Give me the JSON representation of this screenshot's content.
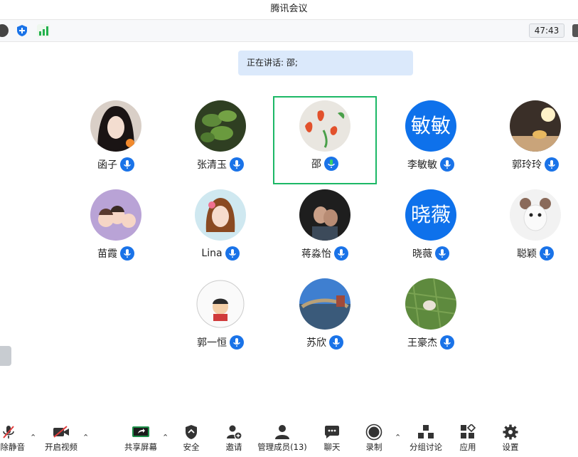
{
  "window": {
    "title": "腾讯会议"
  },
  "infobar": {
    "timer": "47:43"
  },
  "speaking": {
    "text": "正在讲话: 邵;"
  },
  "participants": [
    {
      "name": "函子"
    },
    {
      "name": "张清玉"
    },
    {
      "name": "邵"
    },
    {
      "name": "李敏敏",
      "avatar_text": "敏敏"
    },
    {
      "name": "郭玲玲"
    },
    {
      "name": "苗霞"
    },
    {
      "name": "Lina"
    },
    {
      "name": "蒋淼怡"
    },
    {
      "name": "晓薇",
      "avatar_text": "晓薇"
    },
    {
      "name": "聪颖"
    },
    {
      "name": "郭一恒"
    },
    {
      "name": "苏欣"
    },
    {
      "name": "王豪杰"
    }
  ],
  "toolbar": {
    "unmute": "解除静音",
    "video": "开启视频",
    "share": "共享屏幕",
    "security": "安全",
    "invite": "邀请",
    "members": "管理成员(13)",
    "chat": "聊天",
    "record": "录制",
    "breakout": "分组讨论",
    "apps": "应用",
    "settings": "设置"
  },
  "colors": {
    "accent": "#1a73e8",
    "active_border": "#1cb866",
    "text_avatar": "#0e71eb"
  }
}
